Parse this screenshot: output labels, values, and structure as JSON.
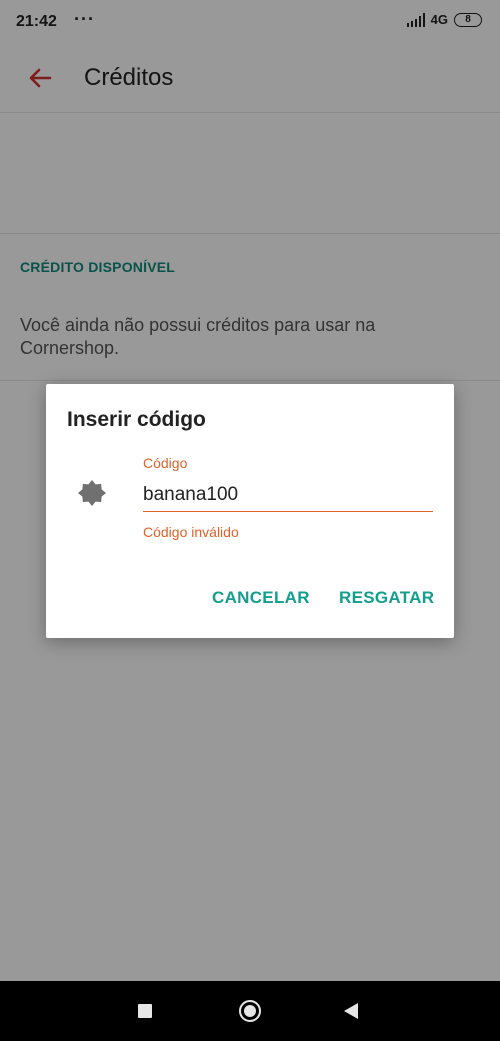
{
  "status_bar": {
    "time": "21:42",
    "dots": "···",
    "network": "4G",
    "battery": "8"
  },
  "toolbar": {
    "title": "Créditos",
    "back_icon": "arrow-left-icon",
    "accent_color": "#d32f2f"
  },
  "credit": {
    "heading": "CRÉDITO DISPONÍVEL",
    "message": "Você ainda não possui créditos para usar na Cornershop."
  },
  "dialog": {
    "title": "Inserir código",
    "field_icon": "badge-icon",
    "field_label": "Código",
    "field_value": "banana100",
    "field_error": "Código inválido",
    "cancel_label": "CANCELAR",
    "redeem_label": "RESGATAR",
    "error_color": "#e0612a",
    "button_color": "#149e8e"
  },
  "nav_bar": {
    "recents_icon": "square-icon",
    "home_icon": "circle-icon",
    "back_icon": "triangle-back-icon"
  }
}
